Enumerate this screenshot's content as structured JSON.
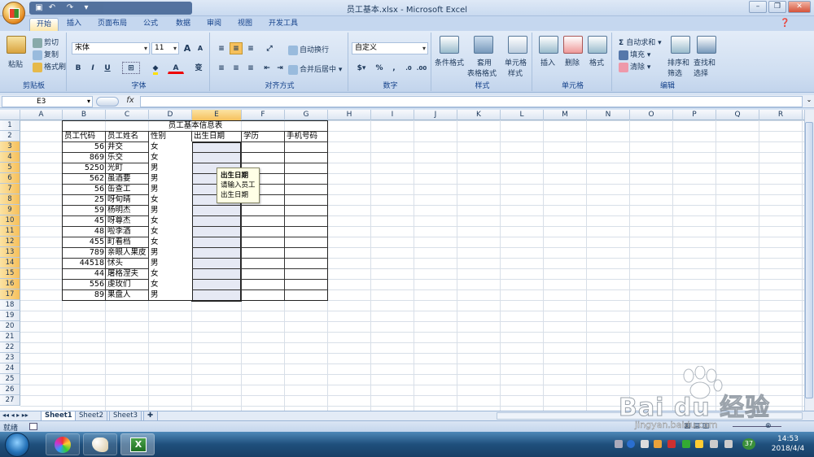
{
  "window": {
    "title": "员工基本.xlsx - Microsoft Excel",
    "minimize": "–",
    "restore": "❐",
    "close": "✕"
  },
  "tabs": [
    "开始",
    "插入",
    "页面布局",
    "公式",
    "数据",
    "审阅",
    "视图",
    "开发工具"
  ],
  "ribbon": {
    "clipboard": {
      "label": "剪贴板",
      "paste": "粘贴",
      "cut": "剪切",
      "copy": "复制",
      "format_painter": "格式刷"
    },
    "font": {
      "label": "字体",
      "name": "宋体",
      "size": "11",
      "grow": "A",
      "shrink": "A",
      "bold": "B",
      "italic": "I",
      "underline": "U",
      "color_a": "A",
      "wen": "变"
    },
    "alignment": {
      "label": "对齐方式",
      "wrap": "自动换行",
      "merge": "合并后居中"
    },
    "number": {
      "label": "数字",
      "format": "自定义",
      "percent": "%",
      "comma": ","
    },
    "styles": {
      "label": "样式",
      "cond": "条件格式",
      "table1": "套用",
      "table2": "表格格式",
      "cell1": "单元格",
      "cell2": "样式"
    },
    "cells": {
      "label": "单元格",
      "insert": "插入",
      "delete": "删除",
      "format": "格式"
    },
    "editing": {
      "label": "编辑",
      "autosum": "自动求和",
      "fill": "填充",
      "clear": "清除",
      "sort1": "排序和",
      "sort2": "筛选",
      "find1": "查找和",
      "find2": "选择"
    }
  },
  "formula_bar": {
    "name_box": "E3",
    "fx": "fx",
    "value": ""
  },
  "columns": [
    "A",
    "B",
    "C",
    "D",
    "E",
    "F",
    "G",
    "H",
    "I",
    "J",
    "K",
    "L",
    "M",
    "N",
    "O",
    "P",
    "Q",
    "R"
  ],
  "rows": [
    "1",
    "2",
    "3",
    "4",
    "5",
    "6",
    "7",
    "8",
    "9",
    "10",
    "11",
    "12",
    "13",
    "14",
    "15",
    "16",
    "17",
    "18",
    "19",
    "20",
    "21",
    "22",
    "23",
    "24",
    "25",
    "26",
    "27"
  ],
  "sheet": {
    "title": "员工基本信息表",
    "headers": [
      "员工代码",
      "员工姓名",
      "性别",
      "出生日期",
      "学历",
      "手机号码"
    ],
    "records": [
      {
        "code": "56",
        "name": "井交",
        "sex": "女"
      },
      {
        "code": "869",
        "name": "乐交",
        "sex": "女"
      },
      {
        "code": "5250",
        "name": "光町",
        "sex": "男"
      },
      {
        "code": "562",
        "name": "虽酒要",
        "sex": "男"
      },
      {
        "code": "56",
        "name": "缶查工",
        "sex": "男"
      },
      {
        "code": "25",
        "name": "呀旬晴",
        "sex": "女"
      },
      {
        "code": "59",
        "name": "杨明杰",
        "sex": "男"
      },
      {
        "code": "45",
        "name": "呀尊杰",
        "sex": "女"
      },
      {
        "code": "48",
        "name": "啦李酒",
        "sex": "女"
      },
      {
        "code": "455",
        "name": "町看档",
        "sex": "女"
      },
      {
        "code": "789",
        "name": "亲眼人果皮",
        "sex": "男"
      },
      {
        "code": "44518",
        "name": "怵头",
        "sex": "男"
      },
      {
        "code": "44",
        "name": "屠格涅夫",
        "sex": "女"
      },
      {
        "code": "556",
        "name": "虔玫们",
        "sex": "女"
      },
      {
        "code": "89",
        "name": "果盘人",
        "sex": "男"
      }
    ]
  },
  "tooltip": {
    "title": "出生日期",
    "line1": "请输入员工",
    "line2": "出生日期"
  },
  "sheet_tabs": [
    "Sheet1",
    "Sheet2",
    "Sheet3"
  ],
  "status": {
    "ready": "就绪"
  },
  "taskbar": {
    "time": "14:53",
    "date": "2018/4/4",
    "badge": "37"
  },
  "watermark": {
    "logo": "Bai du 经验",
    "url": "jingyan.baidu.com"
  },
  "colors": {
    "accent": "#15428b",
    "selection": "#f6c05c"
  }
}
